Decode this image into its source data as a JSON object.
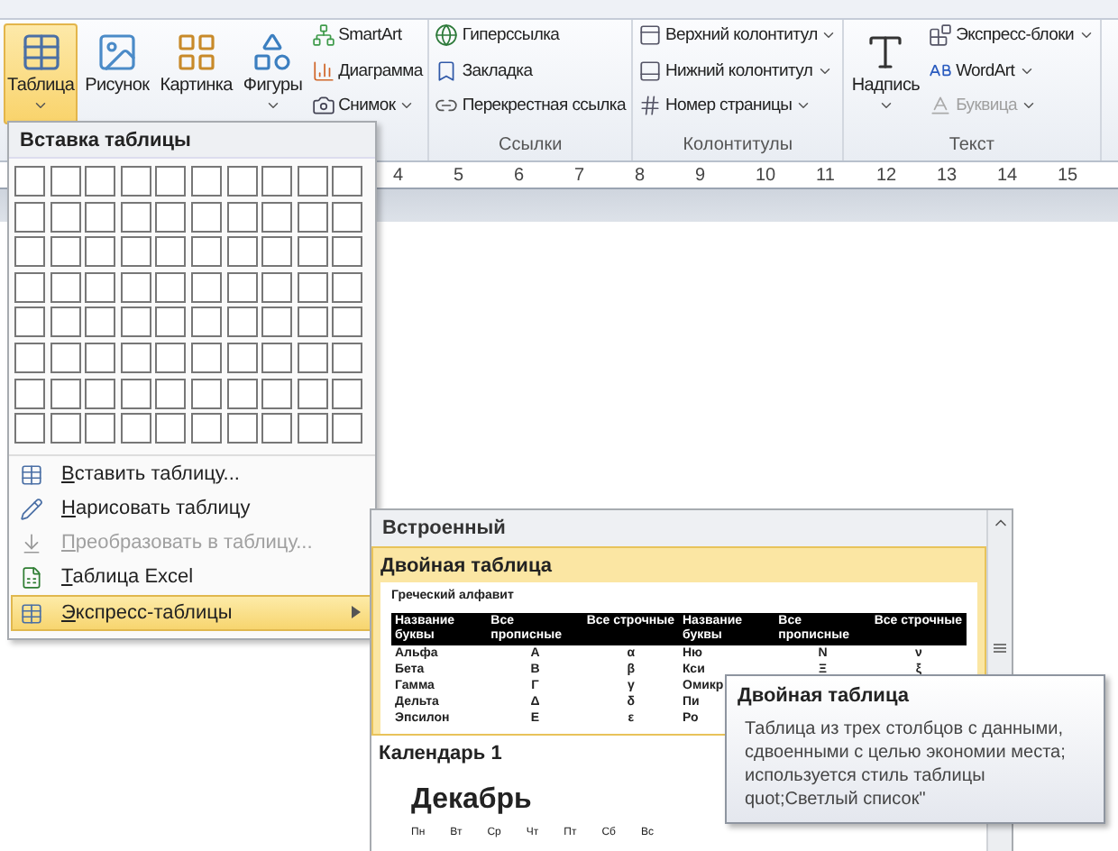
{
  "ribbon": {
    "groups": [
      {
        "large": [
          {
            "label": "Таблица",
            "dropdown": true,
            "selected": true
          },
          {
            "label": "Рисунок",
            "dropdown": false,
            "selected": false
          },
          {
            "label": "Картинка",
            "dropdown": false,
            "selected": false
          },
          {
            "label": "Фигуры",
            "dropdown": true,
            "selected": false
          }
        ],
        "small": [
          {
            "label": "SmartArt",
            "dropdown": false,
            "disabled": false
          },
          {
            "label": "Диаграмма",
            "dropdown": false,
            "disabled": false
          },
          {
            "label": "Снимок",
            "dropdown": true,
            "disabled": false
          }
        ]
      },
      {
        "label": "Ссылки",
        "small": [
          {
            "label": "Гиперссылка",
            "dropdown": false,
            "disabled": false
          },
          {
            "label": "Закладка",
            "dropdown": false,
            "disabled": false
          },
          {
            "label": "Перекрестная ссылка",
            "dropdown": false,
            "disabled": false
          }
        ]
      },
      {
        "label": "Колонтитулы",
        "small": [
          {
            "label": "Верхний колонтитул",
            "dropdown": true,
            "disabled": false
          },
          {
            "label": "Нижний колонтитул",
            "dropdown": true,
            "disabled": false
          },
          {
            "label": "Номер страницы",
            "dropdown": true,
            "disabled": false
          }
        ]
      },
      {
        "label": "Текст",
        "large": [
          {
            "label": "Надпись",
            "dropdown": true,
            "selected": false
          }
        ],
        "small": [
          {
            "label": "Экспресс-блоки",
            "dropdown": true,
            "disabled": false
          },
          {
            "label": "WordArt",
            "dropdown": true,
            "disabled": false
          },
          {
            "label": "Буквица",
            "dropdown": true,
            "disabled": true
          }
        ]
      }
    ]
  },
  "ruler": [
    "4",
    "5",
    "6",
    "7",
    "8",
    "9",
    "10",
    "11",
    "12",
    "13",
    "14",
    "15"
  ],
  "table_menu": {
    "title": "Вставка таблицы",
    "items": [
      {
        "label": "Вставить таблицу...",
        "disabled": false,
        "selected": false,
        "submenu": false
      },
      {
        "label": "Нарисовать таблицу",
        "disabled": false,
        "selected": false,
        "submenu": false
      },
      {
        "label": "Преобразовать в таблицу...",
        "disabled": true,
        "selected": false,
        "submenu": false
      },
      {
        "label": "Таблица Excel",
        "disabled": false,
        "selected": false,
        "submenu": false
      },
      {
        "label": "Экспресс-таблицы",
        "disabled": false,
        "selected": true,
        "submenu": true
      }
    ]
  },
  "gallery": {
    "header": "Встроенный",
    "items": [
      {
        "kind": "table",
        "title": "Двойная таблица",
        "selected": true,
        "caption": "Греческий алфавит",
        "columns": [
          "Название буквы",
          "Все прописные",
          "Все строчные",
          "Название буквы",
          "Все прописные",
          "Все строчные"
        ],
        "rows": [
          [
            "Альфа",
            "Α",
            "α",
            "Ню",
            "Ν",
            "ν"
          ],
          [
            "Бета",
            "Β",
            "β",
            "Кси",
            "Ξ",
            "ξ"
          ],
          [
            "Гамма",
            "Γ",
            "γ",
            "Омикр"
          ],
          [
            "Дельта",
            "Δ",
            "δ",
            "Пи"
          ],
          [
            "Эпсилон",
            "Ε",
            "ε",
            "Ро"
          ]
        ]
      },
      {
        "kind": "calendar",
        "title": "Календарь 1",
        "selected": false,
        "month": "Декабрь",
        "days": [
          "Пн",
          "Вт",
          "Ср",
          "Чт",
          "Пт",
          "Сб",
          "Вс"
        ]
      }
    ]
  },
  "tooltip": {
    "title": "Двойная таблица",
    "text": "Таблица из трех столбцов с данными, сдвоенными с целью экономии места; используется стиль таблицы quot;Светлый список\""
  }
}
